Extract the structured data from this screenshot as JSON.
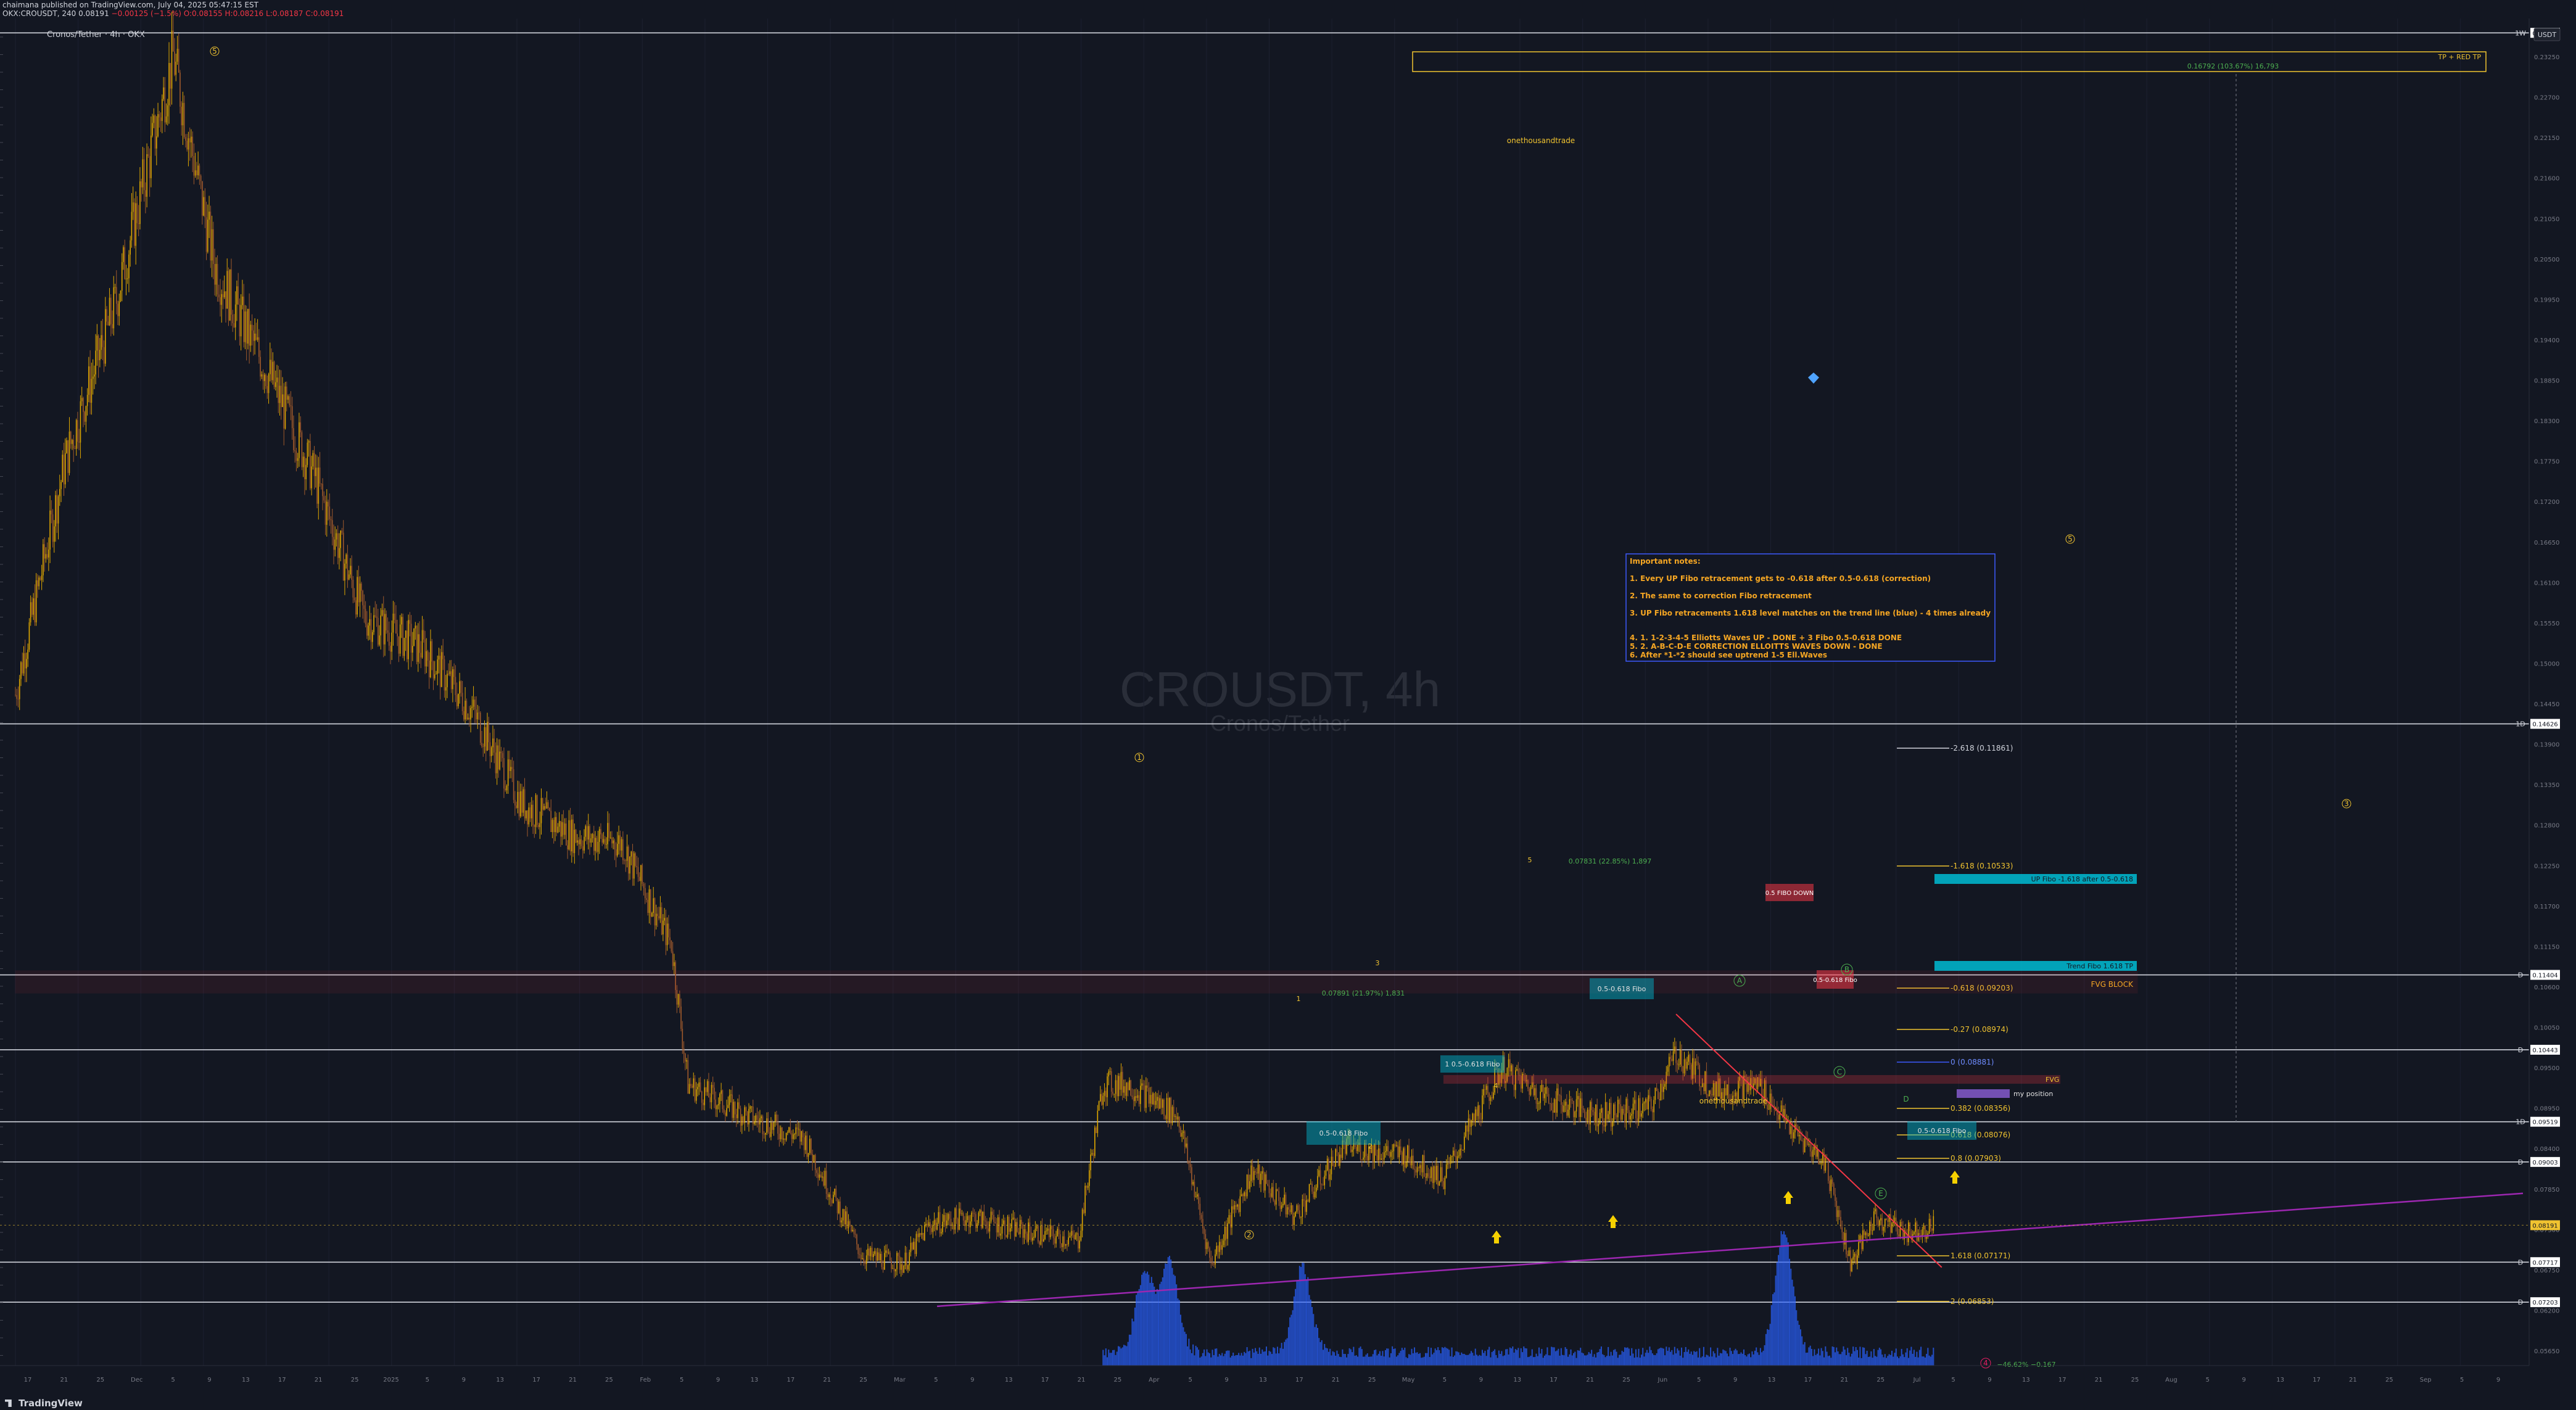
{
  "header": {
    "published": "chaimana published on TradingView.com, July 04, 2025 05:47:15 EST",
    "ohlc_prefix": "OKX:CROUSDT, 240",
    "last": "0.08191",
    "change": "−0.00125 (−1.5%)",
    "open": "O:0.08155",
    "high": "H:0.08216",
    "low": "L:0.08187",
    "close": "C:0.08191",
    "symbol_title": "Cronos/Tether · 4h · OKX"
  },
  "watermark": {
    "main": "CROUSDT, 4h",
    "sub": "Cronos/Tether"
  },
  "currency_button": "USDT",
  "brand": "TradingView",
  "author_tag": "onethousandtrade",
  "notes": {
    "title": "Important notes:",
    "lines": [
      "1. Every UP Fibo retracement gets to -0.618 after 0.5-0.618 (correction)",
      "2. The same to correction Fibo retracement",
      "3. UP Fibo retracements 1.618 level matches on the trend line (blue) - 4 times already",
      "4. 1. 1-2-3-4-5 Elliotts Waves UP - DONE  + 3 Fibo 0.5-0.618 DONE",
      "5. 2. A-B-C-D-E CORRECTION ELLOITTS WAVES DOWN  - DONE",
      "6. After *1-*2 should see uptrend 1-5 Ell.Waves"
    ]
  },
  "fibo_labels": [
    "-2.618 (0.11861)",
    "-1.618 (0.10533)",
    "-0.618 (0.09203)",
    "-0.27 (0.08974)",
    "0 (0.08881)",
    "0.382 (0.08356)",
    "0.5 (0.08195)",
    "0.618 (0.08076)",
    "0.8 (0.07903)",
    "1.618 (0.07171)",
    "2 (0.06853)"
  ],
  "boxes": {
    "up_fibo": "UP Fibo -1.618 after 0.5-0.618",
    "trend_fibo": "Trend Fibo 1.618 TP",
    "fvg_block": "FVG BLOCK",
    "fvg": "FVG",
    "my_position": "my position",
    "fibo_down": "0.5 FIBO DOWN",
    "fibo_box1": "0.5-0.618 Fibo",
    "fibo_box2": "1 0.5-0.618 Fibo",
    "fibo_box3": "0.5-0.618 Fibo",
    "fibo_box4": "0.5-0.618 Fibo",
    "red_box": "0.5-0.618 Fibo",
    "top_target": "TP + RED TP",
    "top_target_sub": "0.16792 (103.67%) 16,793",
    "measure_label": "0.07831 (22.85%) 1,897",
    "measure_label2": "0.07891 (21.97%) 1,831",
    "bottom_measure": "−46.62% −0.167"
  },
  "wave_labels": [
    "5",
    "1",
    "2",
    "3",
    "4",
    "5",
    "3",
    "4",
    "1",
    "A",
    "B",
    "C",
    "D",
    "E",
    "3",
    "5",
    "1",
    "2",
    "4"
  ],
  "price_axis": {
    "ticks": [
      "0.23250",
      "0.22700",
      "0.22150",
      "0.21600",
      "0.21050",
      "0.20500",
      "0.19950",
      "0.19400",
      "0.18850",
      "0.18300",
      "0.17750",
      "0.17200",
      "0.16650",
      "0.16100",
      "0.15550",
      "0.15000",
      "0.14450",
      "0.13900",
      "0.13350",
      "0.12800",
      "0.12250",
      "0.11700",
      "0.11150",
      "0.10600",
      "0.10050",
      "0.09500",
      "0.08950",
      "0.08400",
      "0.07850",
      "0.07300",
      "0.06750",
      "0.06200",
      "0.05650"
    ],
    "tags": [
      {
        "label": "0.23495",
        "color": "#ffffff"
      },
      {
        "label": "0.14626",
        "color": "#ffffff"
      },
      {
        "label": "0.11404",
        "color": "#ffffff"
      },
      {
        "label": "0.10443",
        "color": "#ffffff"
      },
      {
        "label": "0.09519",
        "color": "#ffffff"
      },
      {
        "label": "0.09003",
        "color": "#ffffff"
      },
      {
        "label": "0.08191",
        "color": "#f0c330"
      },
      {
        "label": "0.07717",
        "color": "#ffffff"
      },
      {
        "label": "0.07203",
        "color": "#ffffff"
      }
    ],
    "tf_marks": [
      "1W",
      "1D",
      "D",
      "D",
      "1D",
      "D",
      "D",
      "D"
    ]
  },
  "time_axis": {
    "labels": [
      "17",
      "21",
      "25",
      "Dec",
      "5",
      "9",
      "13",
      "17",
      "21",
      "25",
      "2025",
      "5",
      "9",
      "13",
      "17",
      "21",
      "25",
      "Feb",
      "5",
      "9",
      "13",
      "17",
      "21",
      "25",
      "Mar",
      "5",
      "9",
      "13",
      "17",
      "21",
      "25",
      "Apr",
      "5",
      "9",
      "13",
      "17",
      "21",
      "25",
      "May",
      "5",
      "9",
      "13",
      "17",
      "21",
      "25",
      "Jun",
      "5",
      "9",
      "13",
      "17",
      "21",
      "25",
      "Jul",
      "5",
      "9",
      "13",
      "17",
      "21",
      "25",
      "Aug",
      "5",
      "9",
      "13",
      "17",
      "21",
      "25",
      "Sep",
      "5",
      "9"
    ]
  },
  "chart_data": {
    "type": "candlestick",
    "symbol": "CROUSDT",
    "timeframe": "4h",
    "exchange": "OKX",
    "ylim": [
      0.065,
      0.236
    ],
    "x_range": [
      "2024-11-14",
      "2025-09-12"
    ],
    "series": [
      {
        "name": "price_path",
        "points": [
          [
            "2024-11-14",
            0.15
          ],
          [
            "2024-11-20",
            0.18
          ],
          [
            "2024-11-26",
            0.2
          ],
          [
            "2024-12-03",
            0.232
          ],
          [
            "2024-12-08",
            0.205
          ],
          [
            "2024-12-15",
            0.19
          ],
          [
            "2024-12-20",
            0.178
          ],
          [
            "2024-12-26",
            0.16
          ],
          [
            "2025-01-02",
            0.156
          ],
          [
            "2025-01-08",
            0.148
          ],
          [
            "2025-01-14",
            0.136
          ],
          [
            "2025-01-20",
            0.132
          ],
          [
            "2025-01-26",
            0.131
          ],
          [
            "2025-02-01",
            0.118
          ],
          [
            "2025-02-03",
            0.1
          ],
          [
            "2025-02-10",
            0.096
          ],
          [
            "2025-02-17",
            0.093
          ],
          [
            "2025-02-24",
            0.078
          ],
          [
            "2025-03-01",
            0.077
          ],
          [
            "2025-03-04",
            0.082
          ],
          [
            "2025-03-09",
            0.083
          ],
          [
            "2025-03-16",
            0.081
          ],
          [
            "2025-03-22",
            0.08
          ],
          [
            "2025-03-25",
            0.1
          ],
          [
            "2025-03-28",
            0.1
          ],
          [
            "2025-04-03",
            0.096
          ],
          [
            "2025-04-07",
            0.077
          ],
          [
            "2025-04-12",
            0.089
          ],
          [
            "2025-04-17",
            0.083
          ],
          [
            "2025-04-23",
            0.092
          ],
          [
            "2025-04-30",
            0.091
          ],
          [
            "2025-05-05",
            0.088
          ],
          [
            "2025-05-12",
            0.102
          ],
          [
            "2025-05-18",
            0.098
          ],
          [
            "2025-05-24",
            0.096
          ],
          [
            "2025-05-30",
            0.097
          ],
          [
            "2025-06-02",
            0.104
          ],
          [
            "2025-06-07",
            0.099
          ],
          [
            "2025-06-12",
            0.1
          ],
          [
            "2025-06-16",
            0.094
          ],
          [
            "2025-06-20",
            0.09
          ],
          [
            "2025-06-23",
            0.077
          ],
          [
            "2025-06-26",
            0.083
          ],
          [
            "2025-06-30",
            0.081
          ],
          [
            "2025-07-03",
            0.0819
          ]
        ]
      }
    ],
    "volume_peaks": [
      [
        "2025-03-30",
        0.55
      ],
      [
        "2025-04-02",
        0.62
      ],
      [
        "2025-04-18",
        0.58
      ],
      [
        "2025-06-15",
        0.82
      ]
    ],
    "horizontal_levels": [
      0.23495,
      0.14626,
      0.11404,
      0.10443,
      0.09519,
      0.09003,
      0.07717,
      0.07203
    ],
    "trendline": {
      "from": [
        "2025-03-05",
        0.0715
      ],
      "to": [
        "2025-09-12",
        0.086
      ]
    },
    "downtrend": {
      "from": [
        "2025-06-02",
        0.109
      ],
      "to": [
        "2025-07-04",
        0.0765
      ]
    },
    "last_price": 0.08191
  }
}
